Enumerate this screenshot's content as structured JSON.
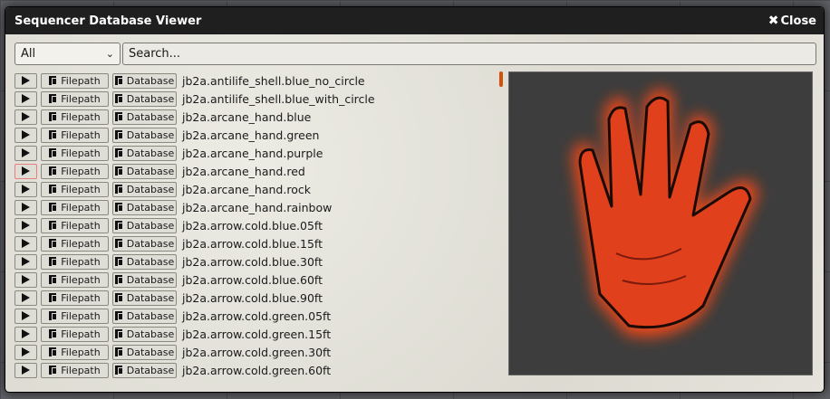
{
  "window": {
    "title": "Sequencer Database Viewer",
    "close_label": "Close"
  },
  "filter": {
    "selected": "All",
    "search_placeholder": "Search..."
  },
  "buttons": {
    "filepath": "Filepath",
    "database": "Database"
  },
  "entries": [
    "jb2a.antilife_shell.blue_no_circle",
    "jb2a.antilife_shell.blue_with_circle",
    "jb2a.arcane_hand.blue",
    "jb2a.arcane_hand.green",
    "jb2a.arcane_hand.purple",
    "jb2a.arcane_hand.red",
    "jb2a.arcane_hand.rock",
    "jb2a.arcane_hand.rainbow",
    "jb2a.arrow.cold.blue.05ft",
    "jb2a.arrow.cold.blue.15ft",
    "jb2a.arrow.cold.blue.30ft",
    "jb2a.arrow.cold.blue.60ft",
    "jb2a.arrow.cold.blue.90ft",
    "jb2a.arrow.cold.green.05ft",
    "jb2a.arrow.cold.green.15ft",
    "jb2a.arrow.cold.green.30ft",
    "jb2a.arrow.cold.green.60ft"
  ],
  "highlighted_index": 5,
  "colors": {
    "accent": "#d4500a",
    "titlebar": "#1f1f1f"
  }
}
